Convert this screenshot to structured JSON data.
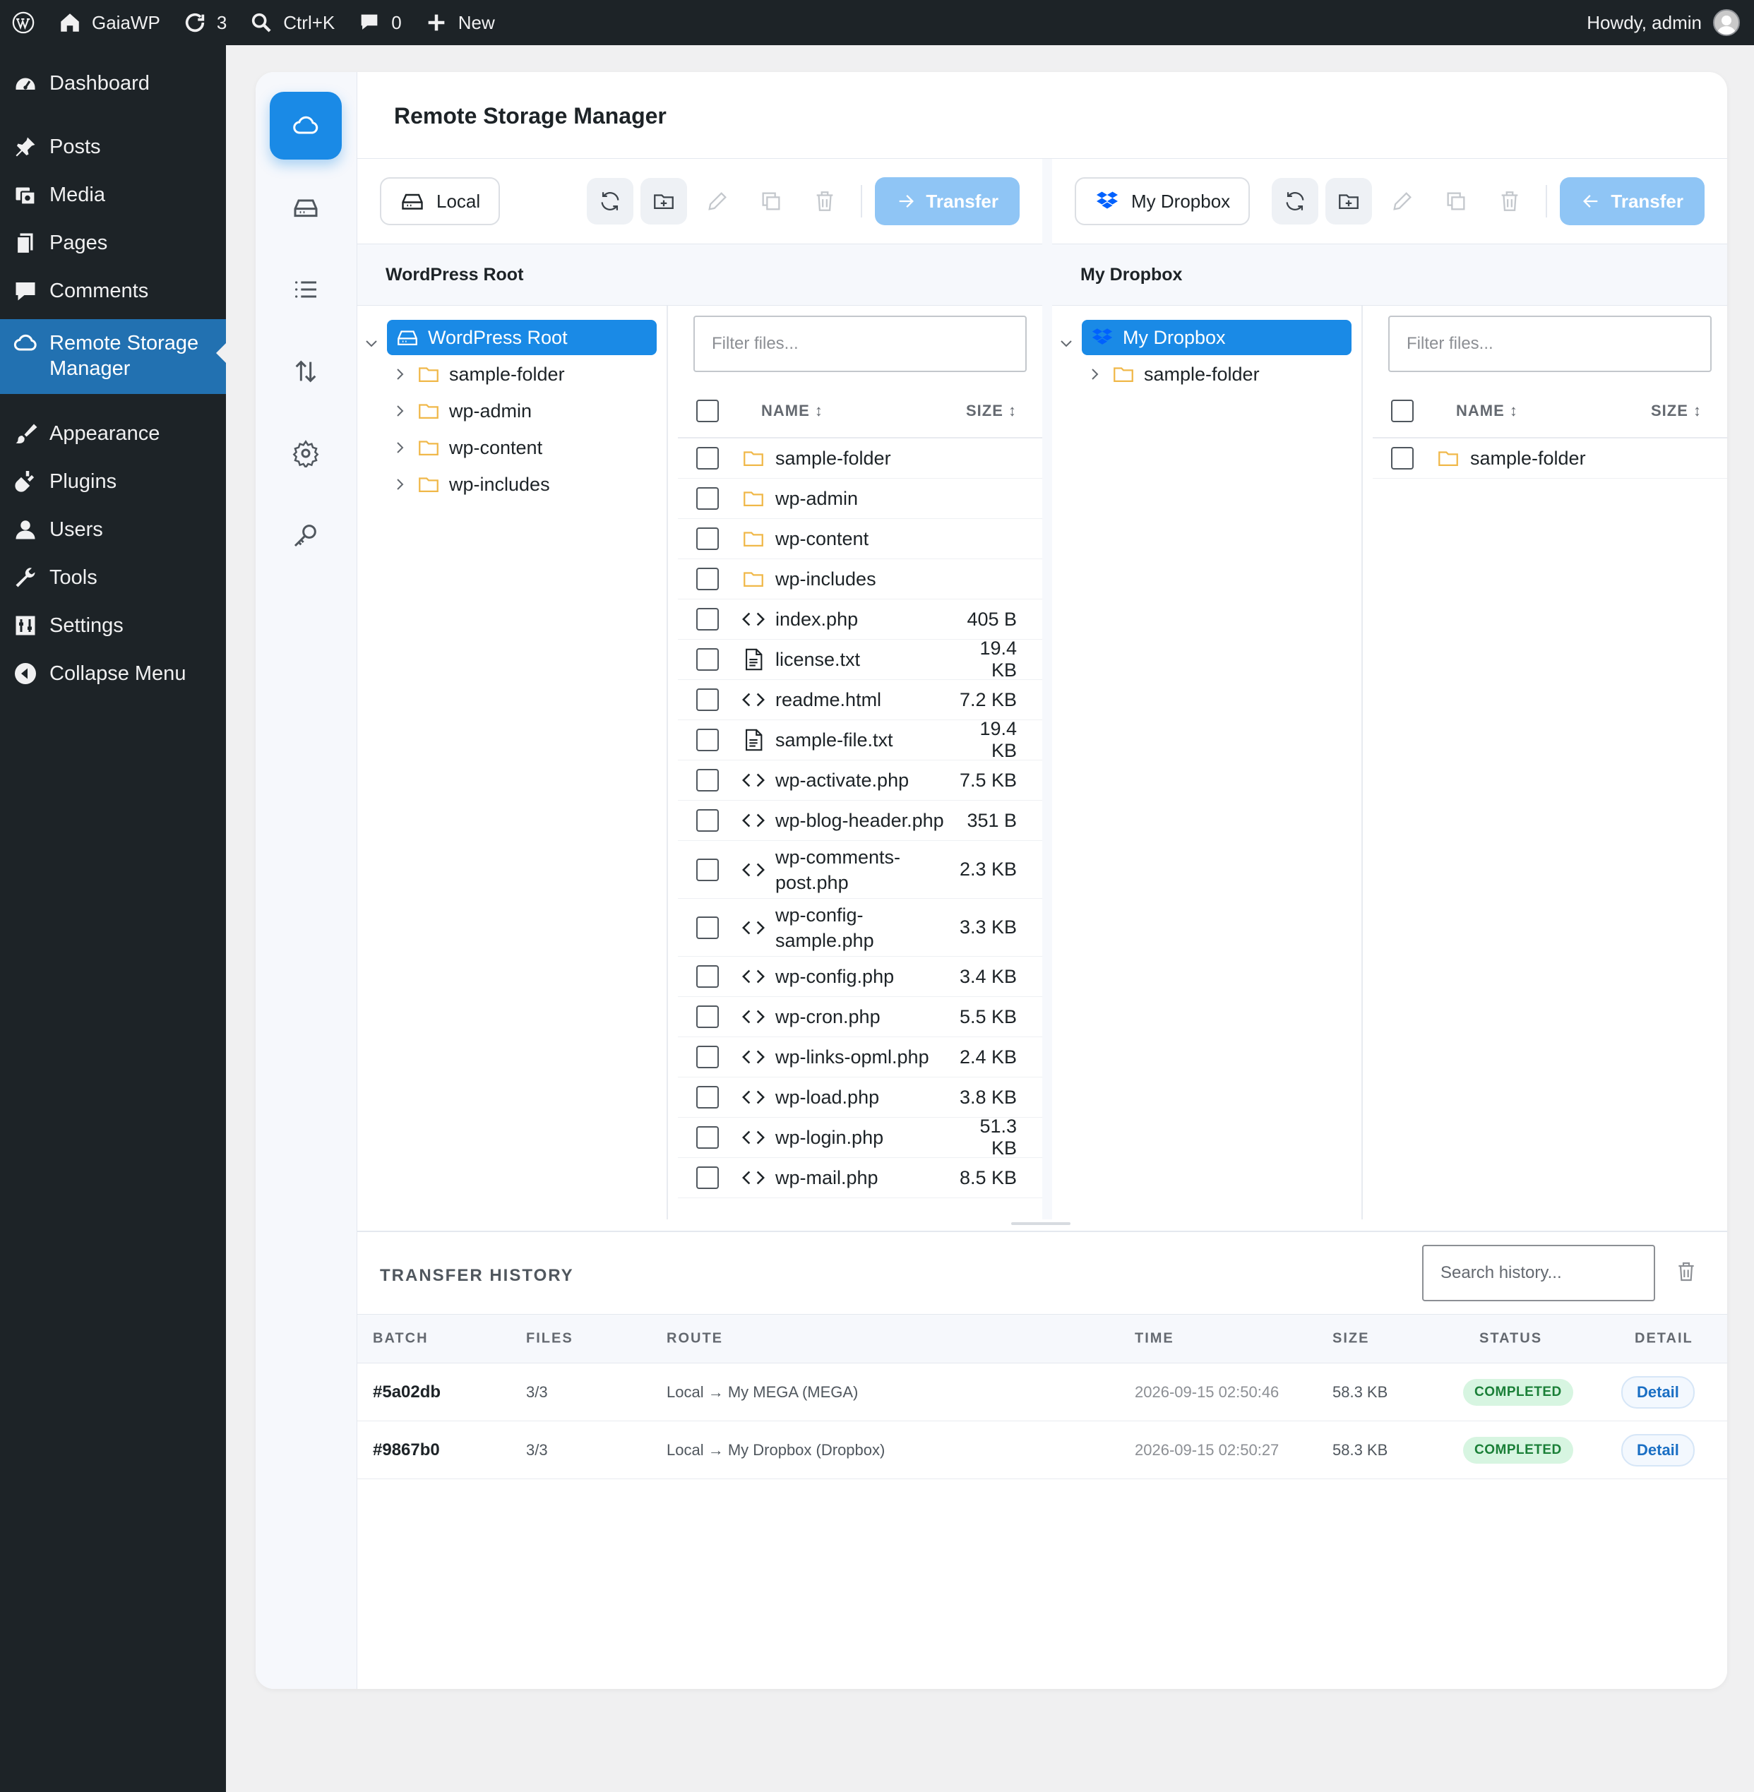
{
  "admin_bar": {
    "site_name": "GaiaWP",
    "updates_count": "3",
    "search_shortcut": "Ctrl+K",
    "comments_count": "0",
    "new_label": "New",
    "howdy": "Howdy, admin"
  },
  "sidebar": {
    "items": [
      {
        "label": "Dashboard",
        "icon": "dashboard-icon"
      },
      {
        "label": "Posts",
        "icon": "pin-icon"
      },
      {
        "label": "Media",
        "icon": "media-icon"
      },
      {
        "label": "Pages",
        "icon": "pages-icon"
      },
      {
        "label": "Comments",
        "icon": "comment-icon"
      },
      {
        "label": "Remote Storage Manager",
        "icon": "cloud-icon",
        "active": true
      },
      {
        "label": "Appearance",
        "icon": "brush-icon"
      },
      {
        "label": "Plugins",
        "icon": "plugin-icon"
      },
      {
        "label": "Users",
        "icon": "user-icon"
      },
      {
        "label": "Tools",
        "icon": "wrench-icon"
      },
      {
        "label": "Settings",
        "icon": "settings-icon"
      },
      {
        "label": "Collapse Menu",
        "icon": "collapse-icon"
      }
    ]
  },
  "page": {
    "title": "Remote Storage Manager"
  },
  "rail": [
    "cloud-icon",
    "drive-icon",
    "list-icon",
    "transfer-arrows-icon",
    "gear-icon",
    "key-icon"
  ],
  "left_pane": {
    "source_label": "Local",
    "transfer_label": "Transfer",
    "path": "WordPress Root",
    "tree_root": "WordPress Root",
    "tree": [
      "sample-folder",
      "wp-admin",
      "wp-content",
      "wp-includes"
    ],
    "filter_placeholder": "Filter files...",
    "col_name": "NAME",
    "col_size": "SIZE",
    "files": [
      {
        "name": "sample-folder",
        "type": "folder",
        "size": ""
      },
      {
        "name": "wp-admin",
        "type": "folder",
        "size": ""
      },
      {
        "name": "wp-content",
        "type": "folder",
        "size": ""
      },
      {
        "name": "wp-includes",
        "type": "folder",
        "size": ""
      },
      {
        "name": "index.php",
        "type": "code",
        "size": "405 B"
      },
      {
        "name": "license.txt",
        "type": "text",
        "size": "19.4 KB"
      },
      {
        "name": "readme.html",
        "type": "code",
        "size": "7.2 KB"
      },
      {
        "name": "sample-file.txt",
        "type": "text",
        "size": "19.4 KB"
      },
      {
        "name": "wp-activate.php",
        "type": "code",
        "size": "7.5 KB"
      },
      {
        "name": "wp-blog-header.php",
        "type": "code",
        "size": "351 B"
      },
      {
        "name": "wp-comments-post.php",
        "type": "code",
        "size": "2.3 KB"
      },
      {
        "name": "wp-config-sample.php",
        "type": "code",
        "size": "3.3 KB"
      },
      {
        "name": "wp-config.php",
        "type": "code",
        "size": "3.4 KB"
      },
      {
        "name": "wp-cron.php",
        "type": "code",
        "size": "5.5 KB"
      },
      {
        "name": "wp-links-opml.php",
        "type": "code",
        "size": "2.4 KB"
      },
      {
        "name": "wp-load.php",
        "type": "code",
        "size": "3.8 KB"
      },
      {
        "name": "wp-login.php",
        "type": "code",
        "size": "51.3 KB"
      },
      {
        "name": "wp-mail.php",
        "type": "code",
        "size": "8.5 KB"
      }
    ]
  },
  "right_pane": {
    "source_label": "My Dropbox",
    "transfer_label": "Transfer",
    "path": "My Dropbox",
    "tree_root": "My Dropbox",
    "tree": [
      "sample-folder"
    ],
    "filter_placeholder": "Filter files...",
    "col_name": "NAME",
    "col_size": "SIZE",
    "files": [
      {
        "name": "sample-folder",
        "type": "folder",
        "size": ""
      }
    ]
  },
  "history": {
    "title": "TRANSFER HISTORY",
    "search_placeholder": "Search history...",
    "columns": [
      "BATCH",
      "FILES",
      "ROUTE",
      "TIME",
      "SIZE",
      "STATUS",
      "DETAIL"
    ],
    "rows": [
      {
        "batch": "#5a02db",
        "files": "3/3",
        "route": "Local → My MEGA (MEGA)",
        "time": "2026-09-15 02:50:46",
        "size": "58.3 KB",
        "status": "COMPLETED",
        "detail": "Detail"
      },
      {
        "batch": "#9867b0",
        "files": "3/3",
        "route": "Local → My Dropbox (Dropbox)",
        "time": "2026-09-15 02:50:27",
        "size": "58.3 KB",
        "status": "COMPLETED",
        "detail": "Detail"
      }
    ]
  },
  "colors": {
    "accent": "#1a8ae6",
    "wp_blue": "#2271b1",
    "folder": "#f0b849",
    "dark": "#1d2327"
  }
}
